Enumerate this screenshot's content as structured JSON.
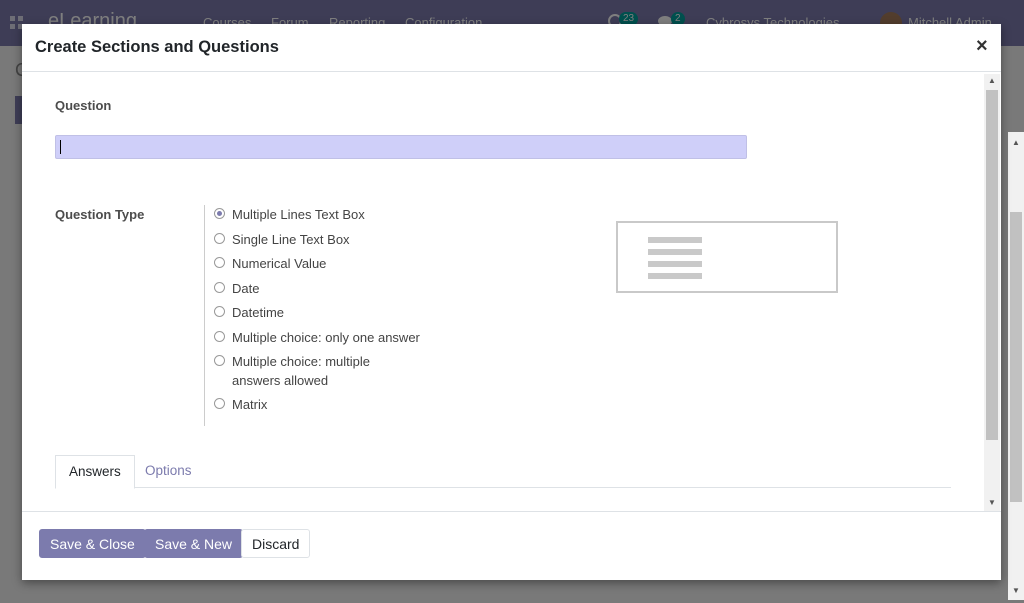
{
  "app": {
    "brand": "eLearning",
    "menu": [
      "Courses",
      "Forum",
      "Reporting",
      "Configuration"
    ],
    "activity_count": "23",
    "message_count": "2",
    "company": "Cybrosys Technologies",
    "user": "Mitchell Admin"
  },
  "modal": {
    "title": "Create Sections and Questions",
    "close_symbol": "×",
    "question_label": "Question",
    "question_value": "",
    "question_type_label": "Question Type",
    "question_types": [
      {
        "label": "Multiple Lines Text Box",
        "checked": true
      },
      {
        "label": "Single Line Text Box",
        "checked": false
      },
      {
        "label": "Numerical Value",
        "checked": false
      },
      {
        "label": "Date",
        "checked": false
      },
      {
        "label": "Datetime",
        "checked": false
      },
      {
        "label": "Multiple choice: only one answer",
        "checked": false
      },
      {
        "label": "Multiple choice: multiple answers allowed",
        "checked": false
      },
      {
        "label": "Matrix",
        "checked": false
      }
    ],
    "tabs": [
      {
        "label": "Answers",
        "active": true
      },
      {
        "label": "Options",
        "active": false
      }
    ]
  },
  "footer": {
    "save_close": "Save & Close",
    "save_new": "Save & New",
    "discard": "Discard"
  },
  "colors": {
    "accent": "#7c7bad",
    "input_bg": "#cfcff9"
  }
}
